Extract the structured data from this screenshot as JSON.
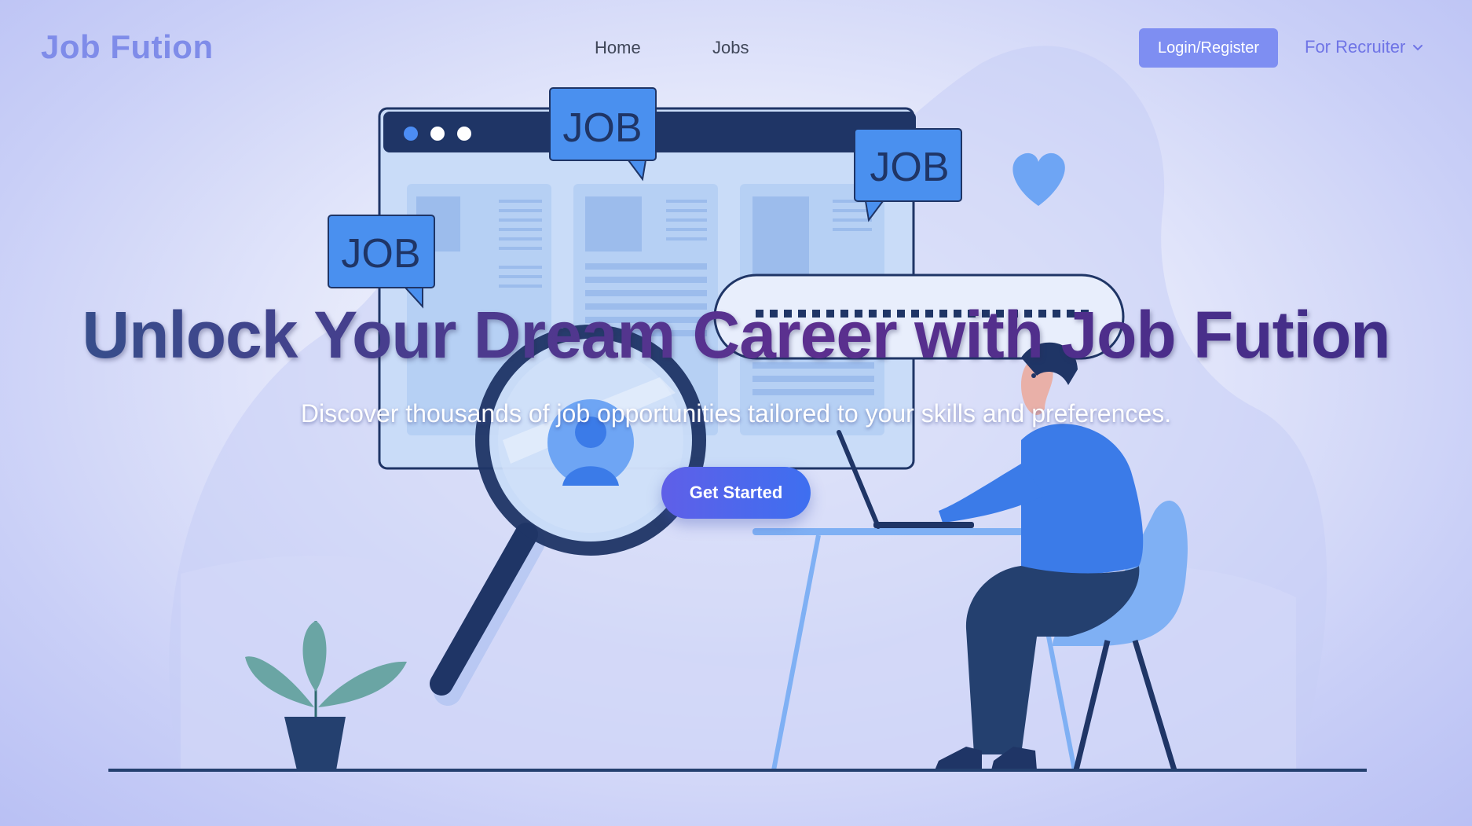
{
  "header": {
    "brand": "Job Fution",
    "nav": {
      "home": "Home",
      "jobs": "Jobs"
    },
    "login_label": "Login/Register",
    "recruiter_label": "For Recruiter"
  },
  "hero": {
    "title": "Unlock Your Dream Career with Job Fution",
    "subtitle": "Discover thousands of job opportunities tailored to your skills and preferences.",
    "cta_label": "Get Started"
  },
  "illustration": {
    "bubble_text": "JOB"
  },
  "colors": {
    "brand": "#7f8ce9",
    "primary_button": "#7e8ef2",
    "cta_start": "#5f5fe8",
    "cta_end": "#3e6ff0",
    "recruiter_link": "#6f74e6"
  },
  "icons": [
    "chevron-down-icon",
    "heart-icon",
    "magnifier-icon",
    "plant-icon",
    "person-icon"
  ]
}
